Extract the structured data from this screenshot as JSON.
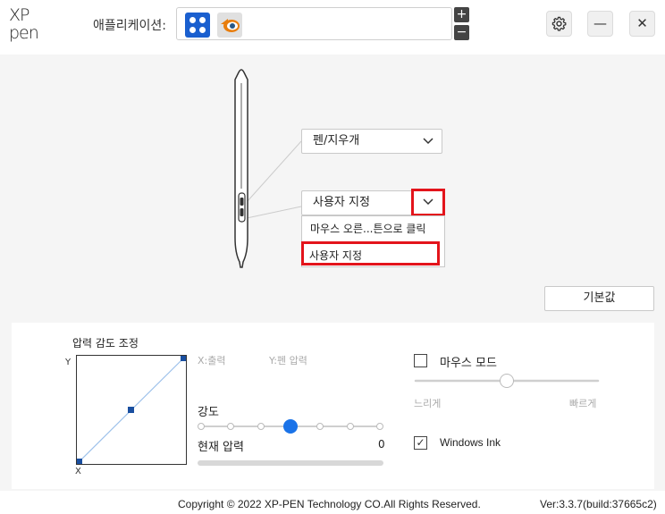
{
  "header": {
    "logo_line1": "XP",
    "logo_line2": "pen",
    "app_label": "애플리케이션:",
    "apps": [
      {
        "icon": "xppen-app-icon",
        "color": "#1a5fcf"
      },
      {
        "icon": "blender-app-icon",
        "color": "#e87d0d"
      }
    ],
    "add_symbol": "+",
    "remove_symbol": "−",
    "settings_icon": "gear-icon",
    "minimize_symbol": "—",
    "close_symbol": "✕"
  },
  "pen": {
    "top_button_value": "펜/지우개",
    "bottom_button_value": "사용자 지정",
    "dropdown_options": [
      "마우스 오른...튼으로 클릭",
      "사용자 지정"
    ],
    "selected_option": "사용자 지정",
    "highlight_color": "#e3141b",
    "default_button": "기본값"
  },
  "pressure": {
    "title": "압력 감도 조정",
    "y_axis": "Y",
    "x_axis": "X",
    "output_label": "X:출력",
    "pen_pressure_label": "Y:펜 압력",
    "strength_label": "강도",
    "strength_level": 0.5,
    "current_pressure_label": "현재 압력",
    "current_pressure_value": "0",
    "accent_color": "#1a73e8"
  },
  "mouse": {
    "mode_label": "마우스 모드",
    "mode_checked": false,
    "slow_label": "느리게",
    "fast_label": "빠르게",
    "speed_level": 0.5,
    "windows_ink_label": "Windows Ink",
    "windows_ink_checked": true,
    "check_symbol": "✓"
  },
  "footer": {
    "copyright": "Copyright © 2022  XP-PEN Technology CO.All Rights Reserved.",
    "version": "Ver:3.3.7(build:37665c2)"
  }
}
